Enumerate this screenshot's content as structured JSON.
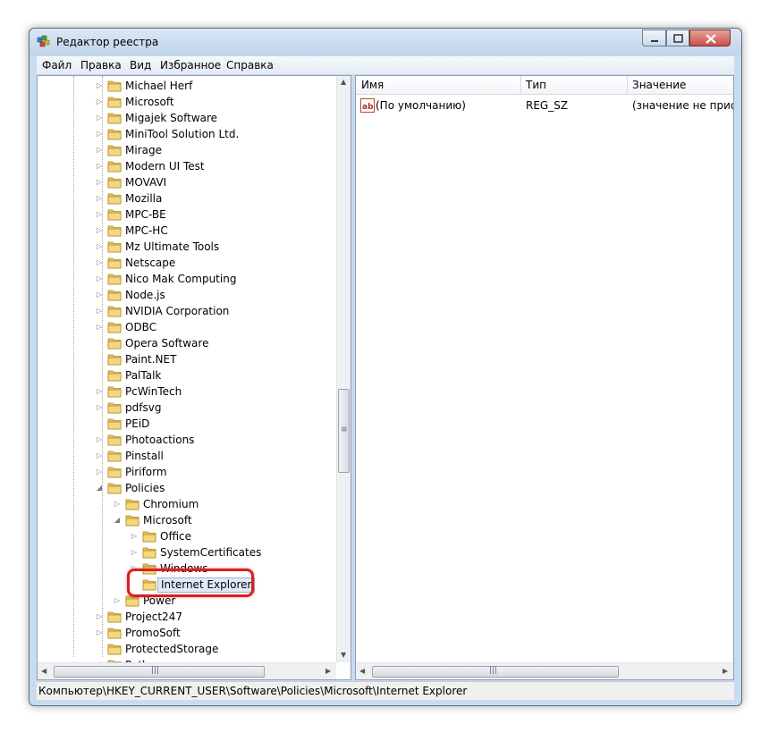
{
  "window": {
    "title": "Редактор реестра"
  },
  "menu": [
    "Файл",
    "Правка",
    "Вид",
    "Избранное",
    "Справка"
  ],
  "tree": {
    "items": [
      {
        "label": "Michael Herf",
        "level": 0,
        "expander": "collapsed"
      },
      {
        "label": "Microsoft",
        "level": 0,
        "expander": "collapsed"
      },
      {
        "label": "Migajek Software",
        "level": 0,
        "expander": "collapsed"
      },
      {
        "label": "MiniTool Solution Ltd.",
        "level": 0,
        "expander": "collapsed"
      },
      {
        "label": "Mirage",
        "level": 0,
        "expander": "collapsed"
      },
      {
        "label": "Modern UI Test",
        "level": 0,
        "expander": "collapsed"
      },
      {
        "label": "MOVAVI",
        "level": 0,
        "expander": "collapsed"
      },
      {
        "label": "Mozilla",
        "level": 0,
        "expander": "collapsed"
      },
      {
        "label": "MPC-BE",
        "level": 0,
        "expander": "collapsed"
      },
      {
        "label": "MPC-HC",
        "level": 0,
        "expander": "collapsed"
      },
      {
        "label": "Mz Ultimate Tools",
        "level": 0,
        "expander": "collapsed"
      },
      {
        "label": "Netscape",
        "level": 0,
        "expander": "collapsed"
      },
      {
        "label": "Nico Mak Computing",
        "level": 0,
        "expander": "collapsed"
      },
      {
        "label": "Node.js",
        "level": 0,
        "expander": "collapsed"
      },
      {
        "label": "NVIDIA Corporation",
        "level": 0,
        "expander": "collapsed"
      },
      {
        "label": "ODBC",
        "level": 0,
        "expander": "collapsed"
      },
      {
        "label": "Opera Software",
        "level": 0,
        "expander": "none"
      },
      {
        "label": "Paint.NET",
        "level": 0,
        "expander": "none"
      },
      {
        "label": "PalTalk",
        "level": 0,
        "expander": "none"
      },
      {
        "label": "PcWinTech",
        "level": 0,
        "expander": "collapsed"
      },
      {
        "label": "pdfsvg",
        "level": 0,
        "expander": "collapsed"
      },
      {
        "label": "PEiD",
        "level": 0,
        "expander": "none"
      },
      {
        "label": "Photoactions",
        "level": 0,
        "expander": "collapsed"
      },
      {
        "label": "Pinstall",
        "level": 0,
        "expander": "collapsed"
      },
      {
        "label": "Piriform",
        "level": 0,
        "expander": "collapsed"
      },
      {
        "label": "Policies",
        "level": 0,
        "expander": "expanded"
      },
      {
        "label": "Chromium",
        "level": 1,
        "expander": "collapsed"
      },
      {
        "label": "Microsoft",
        "level": 1,
        "expander": "expanded"
      },
      {
        "label": "Office",
        "level": 2,
        "expander": "collapsed"
      },
      {
        "label": "SystemCertificates",
        "level": 2,
        "expander": "collapsed"
      },
      {
        "label": "Windows",
        "level": 2,
        "expander": "collapsed"
      },
      {
        "label": "Internet Explorer",
        "level": 2,
        "expander": "none",
        "selected": true
      },
      {
        "label": "Power",
        "level": 1,
        "expander": "collapsed"
      },
      {
        "label": "Project247",
        "level": 0,
        "expander": "collapsed"
      },
      {
        "label": "PromoSoft",
        "level": 0,
        "expander": "collapsed"
      },
      {
        "label": "ProtectedStorage",
        "level": 0,
        "expander": "none"
      },
      {
        "label": "Python",
        "level": 0,
        "expander": "collapsed"
      }
    ]
  },
  "list": {
    "columns": [
      "Имя",
      "Тип",
      "Значение"
    ],
    "rows": [
      {
        "icon": "string-value-icon",
        "name": "(По умолчанию)",
        "type": "REG_SZ",
        "value": "(значение не присво"
      }
    ]
  },
  "statusbar": {
    "path": "Компьютер\\HKEY_CURRENT_USER\\Software\\Policies\\Microsoft\\Internet Explorer"
  },
  "colors": {
    "highlight_ring": "#d92020",
    "folder": "#e8c15a",
    "selection": "#dfeaf7"
  },
  "scroll": {
    "tree_vertical_fraction": 0.6
  }
}
